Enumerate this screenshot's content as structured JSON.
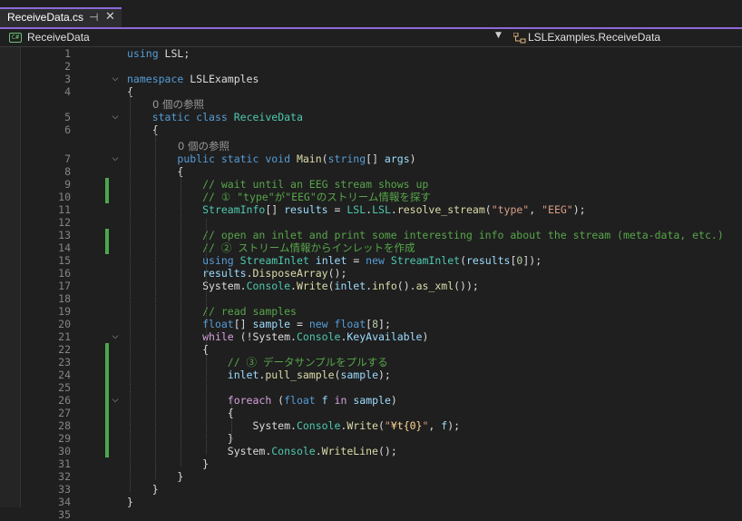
{
  "tab": {
    "title": "ReceiveData.cs",
    "pin": "⊣",
    "close": "✕"
  },
  "nav": {
    "left_label": "ReceiveData",
    "right_label": "LSLExamples.ReceiveData",
    "dropdown": "▼",
    "csharp_badge": "C#"
  },
  "codelens": {
    "ref1": "0 個の参照",
    "ref2": "0 個の参照"
  },
  "lines": [
    {
      "n": "1",
      "t": [
        {
          "c": "kw",
          "s": "using"
        },
        {
          "c": "tx",
          "s": " LSL;"
        }
      ]
    },
    {
      "n": "2",
      "t": []
    },
    {
      "n": "3",
      "t": [
        {
          "c": "kw",
          "s": "namespace"
        },
        {
          "c": "tx",
          "s": " LSLExamples"
        }
      ]
    },
    {
      "n": "4",
      "t": [
        {
          "c": "tx",
          "s": "{"
        }
      ]
    },
    {
      "n": "5",
      "t": [
        {
          "c": "tx",
          "s": "    "
        },
        {
          "c": "kw",
          "s": "static class"
        },
        {
          "c": "tx",
          "s": " "
        },
        {
          "c": "ty",
          "s": "ReceiveData"
        }
      ]
    },
    {
      "n": "6",
      "t": [
        {
          "c": "tx",
          "s": "    {"
        }
      ]
    },
    {
      "n": "7",
      "t": [
        {
          "c": "tx",
          "s": "        "
        },
        {
          "c": "kw",
          "s": "public static void"
        },
        {
          "c": "tx",
          "s": " "
        },
        {
          "c": "mt",
          "s": "Main"
        },
        {
          "c": "tx",
          "s": "("
        },
        {
          "c": "kw",
          "s": "string"
        },
        {
          "c": "tx",
          "s": "[] "
        },
        {
          "c": "pr",
          "s": "args"
        },
        {
          "c": "tx",
          "s": ")"
        }
      ]
    },
    {
      "n": "8",
      "t": [
        {
          "c": "tx",
          "s": "        {"
        }
      ]
    },
    {
      "n": "9",
      "t": [
        {
          "c": "tx",
          "s": "            "
        },
        {
          "c": "cm",
          "s": "// wait until an EEG stream shows up"
        }
      ]
    },
    {
      "n": "10",
      "t": [
        {
          "c": "tx",
          "s": "            "
        },
        {
          "c": "cm",
          "s": "// ① \"type\"が\"EEG\"のストリーム情報を探す"
        }
      ]
    },
    {
      "n": "11",
      "t": [
        {
          "c": "tx",
          "s": "            "
        },
        {
          "c": "ty",
          "s": "StreamInfo"
        },
        {
          "c": "tx",
          "s": "[] "
        },
        {
          "c": "pr",
          "s": "results"
        },
        {
          "c": "tx",
          "s": " = "
        },
        {
          "c": "ty",
          "s": "LSL"
        },
        {
          "c": "tx",
          "s": "."
        },
        {
          "c": "ty",
          "s": "LSL"
        },
        {
          "c": "tx",
          "s": "."
        },
        {
          "c": "mt",
          "s": "resolve_stream"
        },
        {
          "c": "tx",
          "s": "("
        },
        {
          "c": "st",
          "s": "\"type\""
        },
        {
          "c": "tx",
          "s": ", "
        },
        {
          "c": "st",
          "s": "\"EEG\""
        },
        {
          "c": "tx",
          "s": ");"
        }
      ]
    },
    {
      "n": "12",
      "t": []
    },
    {
      "n": "13",
      "t": [
        {
          "c": "tx",
          "s": "            "
        },
        {
          "c": "cm",
          "s": "// open an inlet and print some interesting info about the stream (meta-data, etc.)"
        }
      ]
    },
    {
      "n": "14",
      "t": [
        {
          "c": "tx",
          "s": "            "
        },
        {
          "c": "cm",
          "s": "// ② ストリーム情報からインレットを作成"
        }
      ]
    },
    {
      "n": "15",
      "t": [
        {
          "c": "tx",
          "s": "            "
        },
        {
          "c": "kw",
          "s": "using"
        },
        {
          "c": "tx",
          "s": " "
        },
        {
          "c": "ty",
          "s": "StreamInlet"
        },
        {
          "c": "tx",
          "s": " "
        },
        {
          "c": "pr",
          "s": "inlet"
        },
        {
          "c": "tx",
          "s": " = "
        },
        {
          "c": "kw",
          "s": "new"
        },
        {
          "c": "tx",
          "s": " "
        },
        {
          "c": "ty",
          "s": "StreamInlet"
        },
        {
          "c": "tx",
          "s": "("
        },
        {
          "c": "pr",
          "s": "results"
        },
        {
          "c": "tx",
          "s": "["
        },
        {
          "c": "nu",
          "s": "0"
        },
        {
          "c": "tx",
          "s": "]);"
        }
      ]
    },
    {
      "n": "16",
      "t": [
        {
          "c": "tx",
          "s": "            "
        },
        {
          "c": "pr",
          "s": "results"
        },
        {
          "c": "tx",
          "s": "."
        },
        {
          "c": "mt",
          "s": "DisposeArray"
        },
        {
          "c": "tx",
          "s": "();"
        }
      ]
    },
    {
      "n": "17",
      "t": [
        {
          "c": "tx",
          "s": "            System."
        },
        {
          "c": "ty",
          "s": "Console"
        },
        {
          "c": "tx",
          "s": "."
        },
        {
          "c": "mt",
          "s": "Write"
        },
        {
          "c": "tx",
          "s": "("
        },
        {
          "c": "pr",
          "s": "inlet"
        },
        {
          "c": "tx",
          "s": "."
        },
        {
          "c": "mt",
          "s": "info"
        },
        {
          "c": "tx",
          "s": "()."
        },
        {
          "c": "mt",
          "s": "as_xml"
        },
        {
          "c": "tx",
          "s": "());"
        }
      ]
    },
    {
      "n": "18",
      "t": []
    },
    {
      "n": "19",
      "t": [
        {
          "c": "tx",
          "s": "            "
        },
        {
          "c": "cm",
          "s": "// read samples"
        }
      ]
    },
    {
      "n": "20",
      "t": [
        {
          "c": "tx",
          "s": "            "
        },
        {
          "c": "kw",
          "s": "float"
        },
        {
          "c": "tx",
          "s": "[] "
        },
        {
          "c": "pr",
          "s": "sample"
        },
        {
          "c": "tx",
          "s": " = "
        },
        {
          "c": "kw",
          "s": "new float"
        },
        {
          "c": "tx",
          "s": "["
        },
        {
          "c": "nu",
          "s": "8"
        },
        {
          "c": "tx",
          "s": "];"
        }
      ]
    },
    {
      "n": "21",
      "t": [
        {
          "c": "tx",
          "s": "            "
        },
        {
          "c": "ctl",
          "s": "while"
        },
        {
          "c": "tx",
          "s": " (!System."
        },
        {
          "c": "ty",
          "s": "Console"
        },
        {
          "c": "tx",
          "s": "."
        },
        {
          "c": "pr",
          "s": "KeyAvailable"
        },
        {
          "c": "tx",
          "s": ")"
        }
      ]
    },
    {
      "n": "22",
      "t": [
        {
          "c": "tx",
          "s": "            {"
        }
      ]
    },
    {
      "n": "23",
      "t": [
        {
          "c": "tx",
          "s": "                "
        },
        {
          "c": "cm",
          "s": "// ③ データサンプルをプルする"
        }
      ]
    },
    {
      "n": "24",
      "t": [
        {
          "c": "tx",
          "s": "                "
        },
        {
          "c": "pr",
          "s": "inlet"
        },
        {
          "c": "tx",
          "s": "."
        },
        {
          "c": "mt",
          "s": "pull_sample"
        },
        {
          "c": "tx",
          "s": "("
        },
        {
          "c": "pr",
          "s": "sample"
        },
        {
          "c": "tx",
          "s": ");"
        }
      ]
    },
    {
      "n": "25",
      "t": []
    },
    {
      "n": "26",
      "t": [
        {
          "c": "tx",
          "s": "                "
        },
        {
          "c": "ctl",
          "s": "foreach"
        },
        {
          "c": "tx",
          "s": " ("
        },
        {
          "c": "kw",
          "s": "float"
        },
        {
          "c": "tx",
          "s": " "
        },
        {
          "c": "pr",
          "s": "f"
        },
        {
          "c": "tx",
          "s": " "
        },
        {
          "c": "ctl",
          "s": "in"
        },
        {
          "c": "tx",
          "s": " "
        },
        {
          "c": "pr",
          "s": "sample"
        },
        {
          "c": "tx",
          "s": ")"
        }
      ]
    },
    {
      "n": "27",
      "t": [
        {
          "c": "tx",
          "s": "                {"
        }
      ]
    },
    {
      "n": "28",
      "t": [
        {
          "c": "tx",
          "s": "                    System."
        },
        {
          "c": "ty",
          "s": "Console"
        },
        {
          "c": "tx",
          "s": "."
        },
        {
          "c": "mt",
          "s": "Write"
        },
        {
          "c": "tx",
          "s": "("
        },
        {
          "c": "st",
          "s": "\""
        },
        {
          "c": "es",
          "s": "¥t{0}"
        },
        {
          "c": "st",
          "s": "\""
        },
        {
          "c": "tx",
          "s": ", "
        },
        {
          "c": "pr",
          "s": "f"
        },
        {
          "c": "tx",
          "s": ");"
        }
      ]
    },
    {
      "n": "29",
      "t": [
        {
          "c": "tx",
          "s": "                }"
        }
      ]
    },
    {
      "n": "30",
      "t": [
        {
          "c": "tx",
          "s": "                System."
        },
        {
          "c": "ty",
          "s": "Console"
        },
        {
          "c": "tx",
          "s": "."
        },
        {
          "c": "mt",
          "s": "WriteLine"
        },
        {
          "c": "tx",
          "s": "();"
        }
      ]
    },
    {
      "n": "31",
      "t": [
        {
          "c": "tx",
          "s": "            }"
        }
      ]
    },
    {
      "n": "32",
      "t": [
        {
          "c": "tx",
          "s": "        }"
        }
      ]
    },
    {
      "n": "33",
      "t": [
        {
          "c": "tx",
          "s": "    }"
        }
      ]
    },
    {
      "n": "34",
      "t": [
        {
          "c": "tx",
          "s": "}"
        }
      ]
    },
    {
      "n": "35",
      "t": []
    }
  ]
}
